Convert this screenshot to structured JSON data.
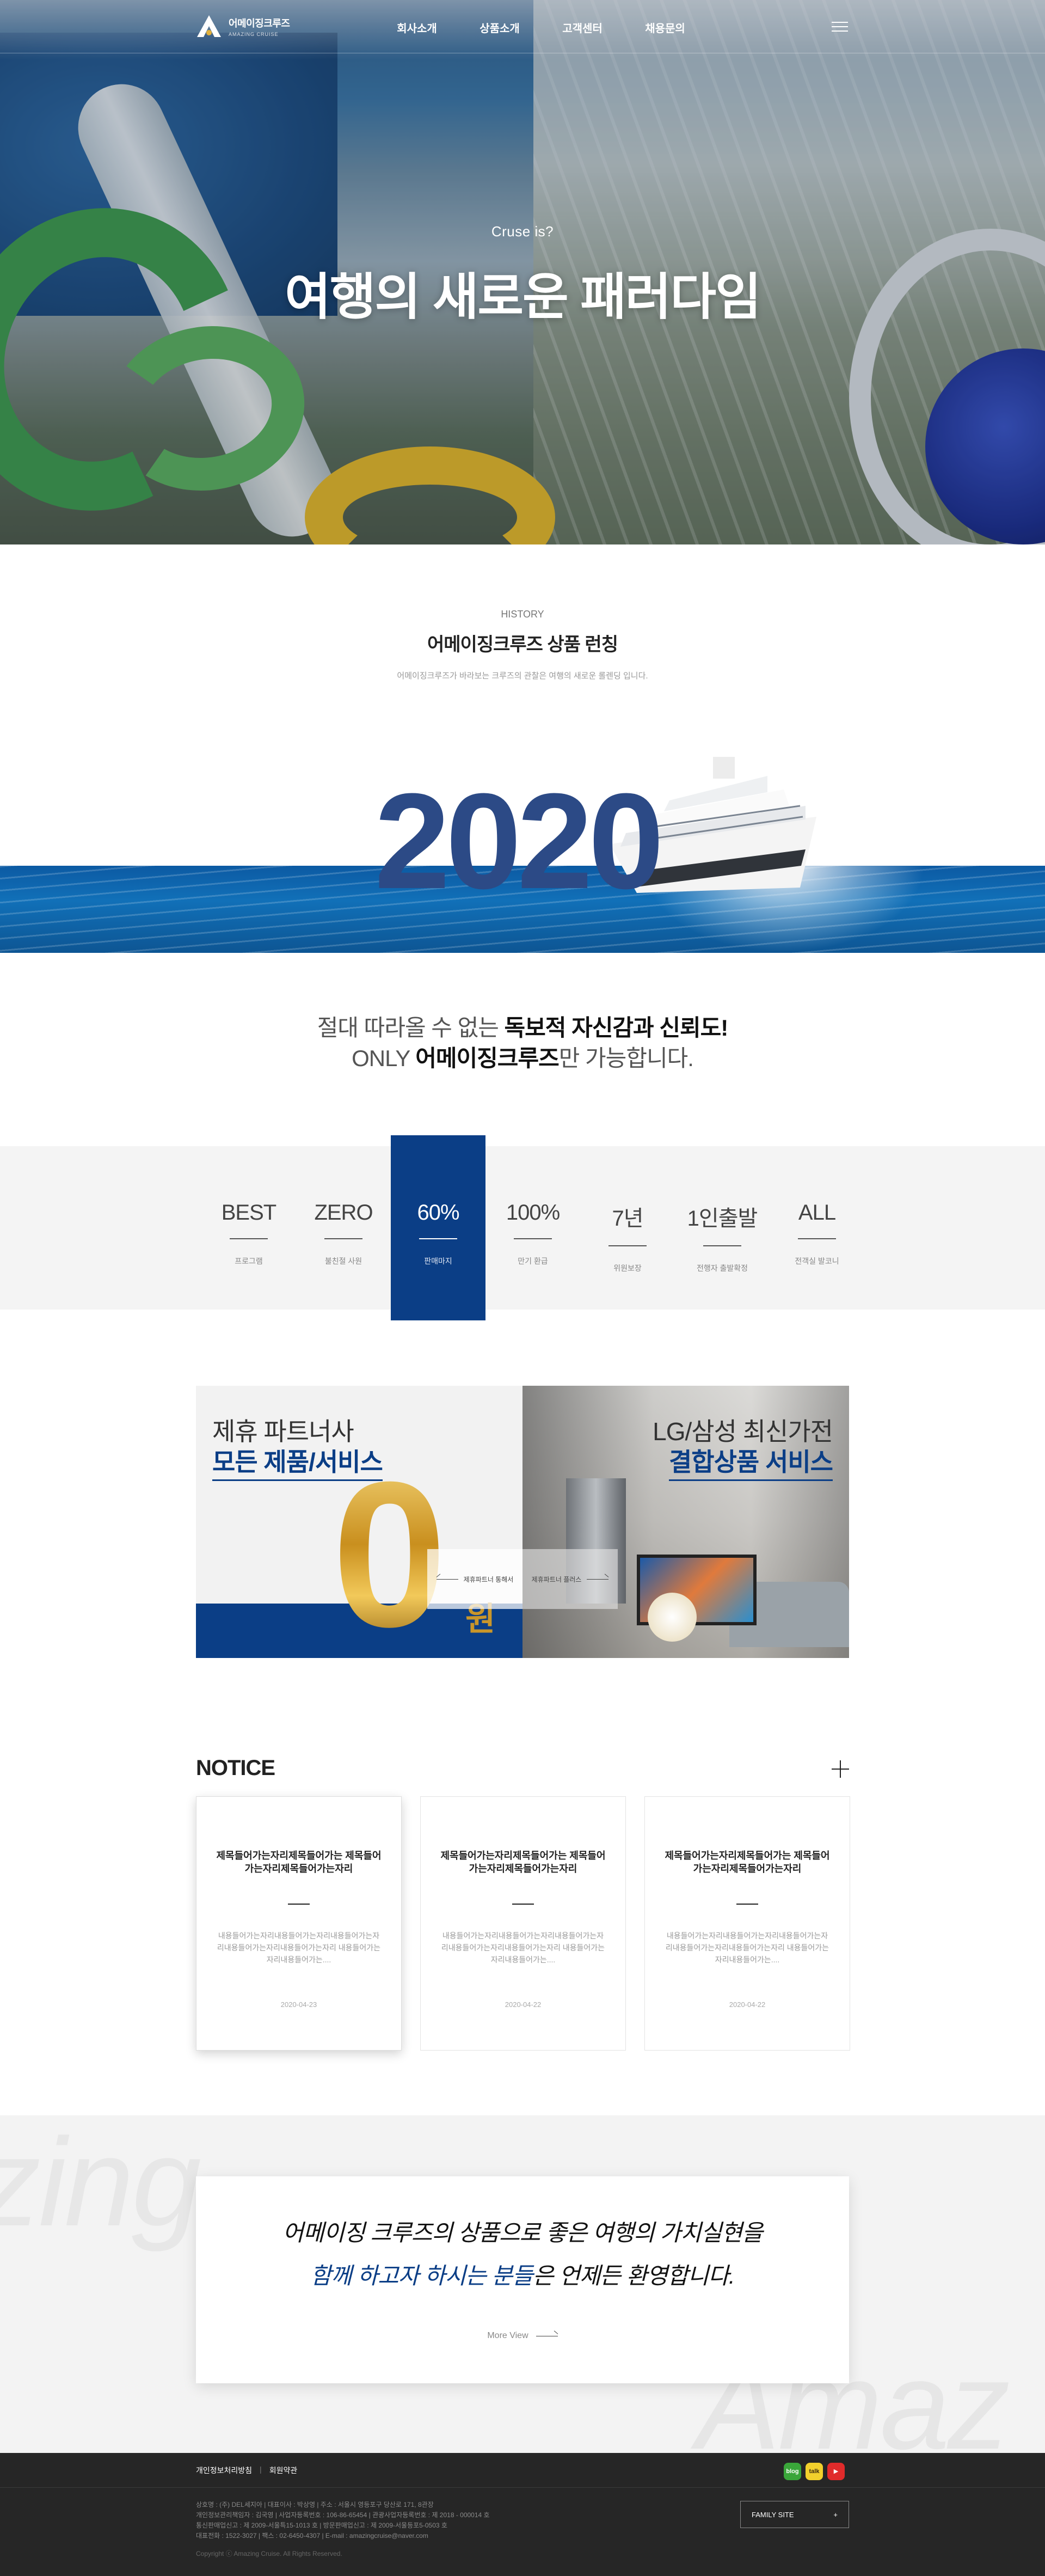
{
  "header": {
    "logo_ko": "어메이징크루즈",
    "logo_en": "AMAZING CRUISE",
    "nav": [
      "회사소개",
      "상품소개",
      "고객센터",
      "채용문의"
    ],
    "menu_icon": "hamburger-icon"
  },
  "hero": {
    "sub": "Cruse is?",
    "title": "여행의 새로운 패러다임"
  },
  "history": {
    "label": "HISTORY",
    "title": "어메이징크루즈 상품  런칭",
    "desc": "어메이징크루즈가 바라보는 크루즈의 관찰은 여행의 새로운 롤렌딩 입니다.",
    "year": "2020"
  },
  "slogan": {
    "line1_pre": "절대 따라올 수 없는 ",
    "line1_bold": "독보적 자신감과 신뢰도!",
    "line2_pre": "ONLY ",
    "line2_bold": "어메이징크루즈",
    "line2_post": "만 가능합니다."
  },
  "stats": [
    {
      "big": "BEST",
      "small": "프로그램",
      "active": false
    },
    {
      "big": "ZERO",
      "small": "불친절 사원",
      "active": false
    },
    {
      "big": "60%",
      "small": "판매마지",
      "active": true
    },
    {
      "big": "100%",
      "small": "만기 환급",
      "active": false
    },
    {
      "big": "7년",
      "small": "위원보장",
      "active": false
    },
    {
      "big": "1인출발",
      "small": "전행자 출발확정",
      "active": false
    },
    {
      "big": "ALL",
      "small": "전객실 발코니",
      "active": false
    }
  ],
  "banners": {
    "left_line1": "제휴 파트너사",
    "left_line2": "모든 제품/서비스",
    "left_zero": "0",
    "left_won": "원",
    "right_line1": "LG/삼성 최신가전",
    "right_line2": "결합상품 서비스",
    "prev_label": "제휴파트너 통해서",
    "next_label": "제휴파트너 플러스"
  },
  "notice": {
    "heading": "NOTICE",
    "cards": [
      {
        "title": "제목들어가는자리제목들어가는 제목들어가는자리제목들어가는자리",
        "body": "내용들어가는자리내용들어가는자리내용들어가는자리내용들어가는자리내용들어가는자리 내용들어가는자리내용들어가는....",
        "date": "2020-04-23"
      },
      {
        "title": "제목들어가는자리제목들어가는 제목들어가는자리제목들어가는자리",
        "body": "내용들어가는자리내용들어가는자리내용들어가는자리내용들어가는자리내용들어가는자리 내용들어가는자리내용들어가는....",
        "date": "2020-04-22"
      },
      {
        "title": "제목들어가는자리제목들어가는 제목들어가는자리제목들어가는자리",
        "body": "내용들어가는자리내용들어가는자리내용들어가는자리내용들어가는자리내용들어가는자리 내용들어가는자리내용들어가는....",
        "date": "2020-04-22"
      }
    ]
  },
  "cta": {
    "line1": "어메이징 크루즈의 상품으로 좋은 여행의 가치실현을",
    "line2_hl": "함께 하고자 하시는 분들",
    "line2_post": "은 언제든 환영합니다.",
    "more": "More View",
    "ghost_left": "zing",
    "ghost_right": "Amaz"
  },
  "footer": {
    "links": [
      "개인정보처리방침",
      "회원약관"
    ],
    "sns": [
      {
        "name": "blog-icon",
        "label": "blog"
      },
      {
        "name": "kakaotalk-icon",
        "label": "talk"
      },
      {
        "name": "youtube-icon",
        "label": "▶"
      }
    ],
    "info": [
      "상호명 : (주) DEL세지아  |  대표이사 : 박상영  |  주소 : 서울시 영등포구 당산로 171, 8관장",
      "개인정보관리책임자 : 김국영  |  사업자등록번호 : 106-86-65454  |  관광사업자등록번호 : 제 2018 - 000014 호",
      "통신판매업신고 : 제 2009-서울특15-1013 호  |  방문판매업신고 : 제 2009-서울등포5-0503 호",
      "대표전화 : 1522-3027  |  팩스 : 02-6450-4307  |  E-mail : amazingcruise@naver.com"
    ],
    "copyright": "Copyright ⓒ Amazing Cruise. All Rights Reserved.",
    "family_site": "FAMILY SITE",
    "family_plus": "+"
  }
}
